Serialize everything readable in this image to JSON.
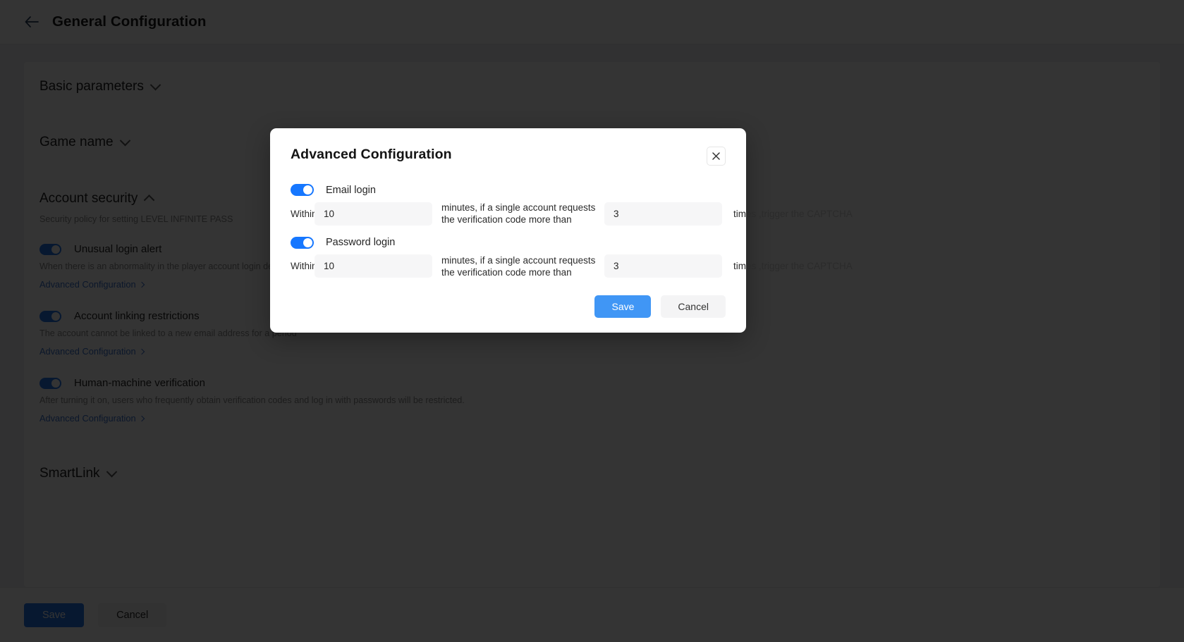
{
  "page": {
    "back_icon": "arrow-left-icon",
    "title": "General Configuration",
    "sections": [
      {
        "label": "Basic parameters",
        "chevron": "chevron-down-icon"
      },
      {
        "label": "Game name",
        "chevron": "chevron-down-icon"
      },
      {
        "label": "Account security",
        "chevron": "chevron-up-icon",
        "subtitle": "Security policy for setting LEVEL INFINITE PASS"
      },
      {
        "label": "SmartLink",
        "chevron": "chevron-down-icon"
      }
    ],
    "security_items": [
      {
        "label": "Unusual login alert",
        "description": "When there is an abnormality in the player account login device",
        "link": "Advanced Configuration",
        "toggle_on": true
      },
      {
        "label": "Account linking restrictions",
        "description": "The account cannot be linked to a new email address for a period",
        "link": "Advanced Configuration",
        "toggle_on": true
      },
      {
        "label": "Human-machine verification",
        "description": "After turning it on, users who frequently obtain verification codes and log in with passwords will be restricted.",
        "link": "Advanced Configuration",
        "toggle_on": true
      }
    ],
    "footer": {
      "save_label": "Save",
      "cancel_label": "Cancel"
    }
  },
  "modal": {
    "title": "Advanced Configuration",
    "close_icon": "close-icon",
    "rules": [
      {
        "toggle_label": "Email login",
        "toggle_on": true,
        "prefix": "Within",
        "minutes_value": "10",
        "middle_text": "minutes, if a single account requests the verification code more than",
        "times_value": "3",
        "suffix": "times ,trigger the CAPTCHA"
      },
      {
        "toggle_label": "Password login",
        "toggle_on": true,
        "prefix": "Within",
        "minutes_value": "10",
        "middle_text": "minutes, if a single account requests the verification code more than",
        "times_value": "3",
        "suffix": "times ,trigger the CAPTCHA"
      }
    ],
    "save_label": "Save",
    "cancel_label": "Cancel"
  },
  "colors": {
    "accent_blue": "#1677ff",
    "modal_save_blue": "#4096f5",
    "link_blue": "#2f6fe0"
  }
}
